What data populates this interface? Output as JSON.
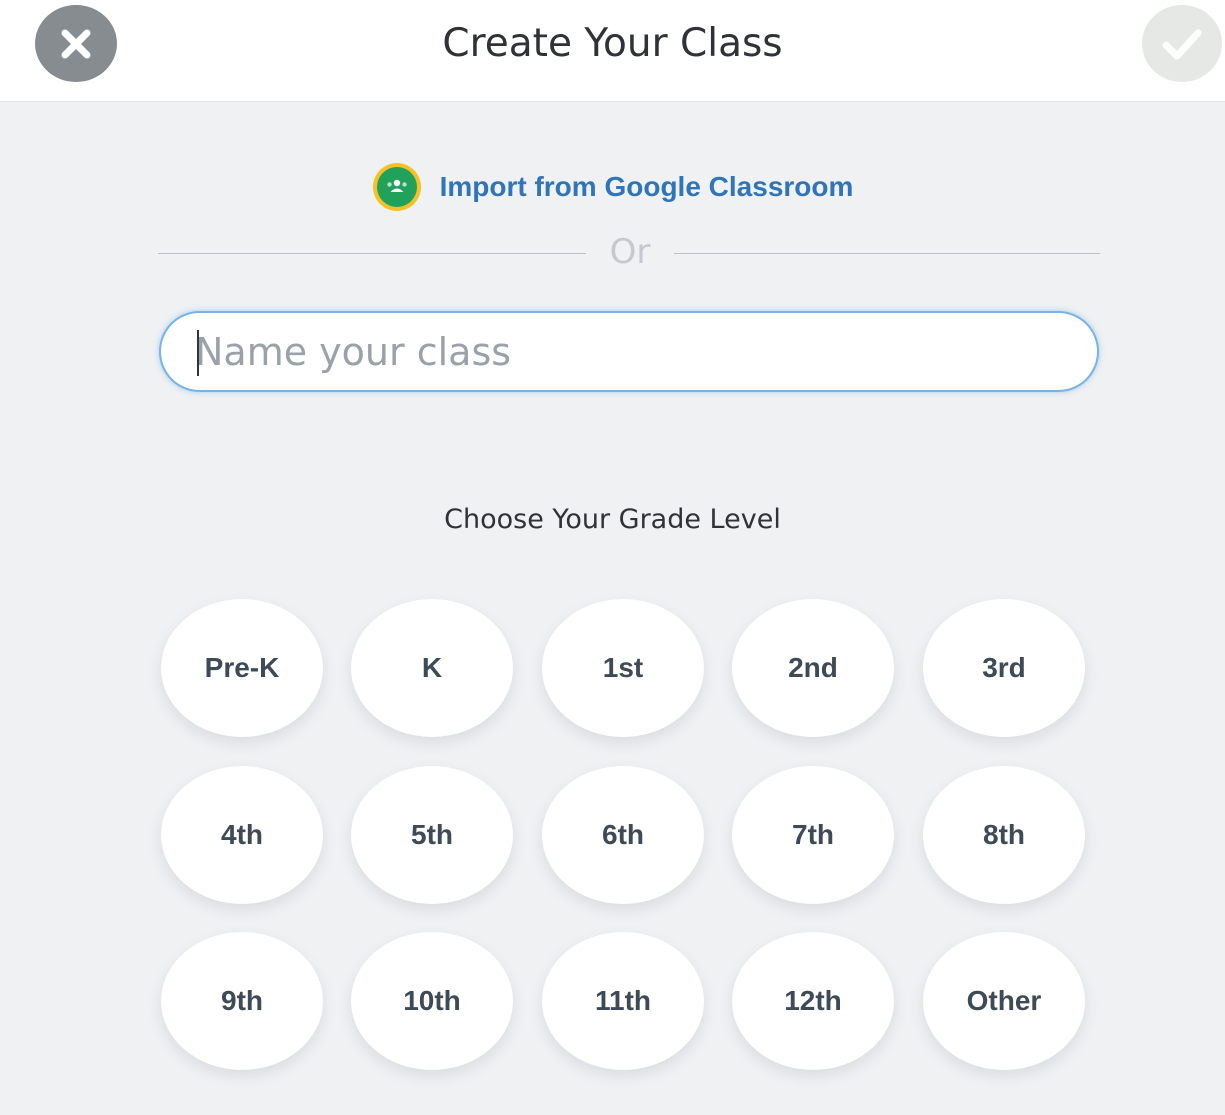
{
  "header": {
    "title": "Create Your Class",
    "close_icon": "close-icon",
    "confirm_icon": "checkmark-icon"
  },
  "import": {
    "label": "Import from Google Classroom",
    "icon": "google-classroom-icon",
    "color": "#2f75b7"
  },
  "divider": {
    "label": "Or"
  },
  "class_name": {
    "value": "",
    "placeholder": "Name your class"
  },
  "grade": {
    "heading": "Choose Your Grade Level",
    "options": [
      "Pre-K",
      "K",
      "1st",
      "2nd",
      "3rd",
      "4th",
      "5th",
      "6th",
      "7th",
      "8th",
      "9th",
      "10th",
      "11th",
      "12th",
      "Other"
    ]
  },
  "colors": {
    "background": "#eff1f3",
    "close_button": "#878c91",
    "confirm_button": "#e5e8e5",
    "input_border": "#79b3e6"
  }
}
